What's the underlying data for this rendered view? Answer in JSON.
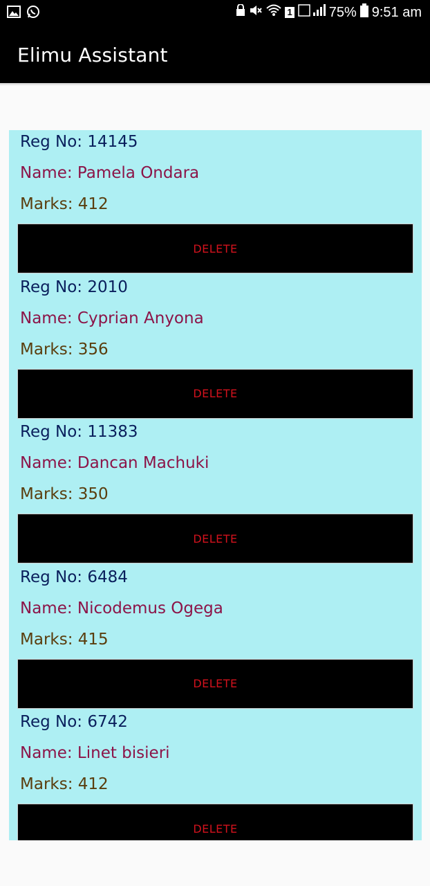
{
  "status_bar": {
    "icons_left": [
      "image-icon",
      "whatsapp-icon"
    ],
    "icons_right": [
      "lock-icon",
      "mute-icon",
      "wifi-icon",
      "sim-icon",
      "signal-icon"
    ],
    "sim_slot": "1",
    "battery": "75%",
    "time": "9:51 am"
  },
  "app_bar": {
    "title": "Elimu Assistant"
  },
  "records": [
    {
      "reg": "Reg No: 14145",
      "name": "Name: Pamela Ondara",
      "marks": "Marks: 412",
      "delete_label": "DELETE"
    },
    {
      "reg": "Reg No: 2010",
      "name": "Name: Cyprian Anyona",
      "marks": "Marks: 356",
      "delete_label": "DELETE"
    },
    {
      "reg": "Reg No: 11383",
      "name": "Name: Dancan Machuki",
      "marks": "Marks: 350",
      "delete_label": "DELETE"
    },
    {
      "reg": "Reg No: 6484",
      "name": "Name: Nicodemus Ogega",
      "marks": "Marks: 415",
      "delete_label": "DELETE"
    },
    {
      "reg": "Reg No: 6742",
      "name": "Name: Linet bisieri",
      "marks": "Marks: 412",
      "delete_label": "DELETE"
    }
  ],
  "colors": {
    "list_background": "#aeeff3",
    "reg_text": "#0a1f5c",
    "name_text": "#8c1448",
    "marks_text": "#5a3d0d",
    "delete_text": "#d3121d"
  }
}
